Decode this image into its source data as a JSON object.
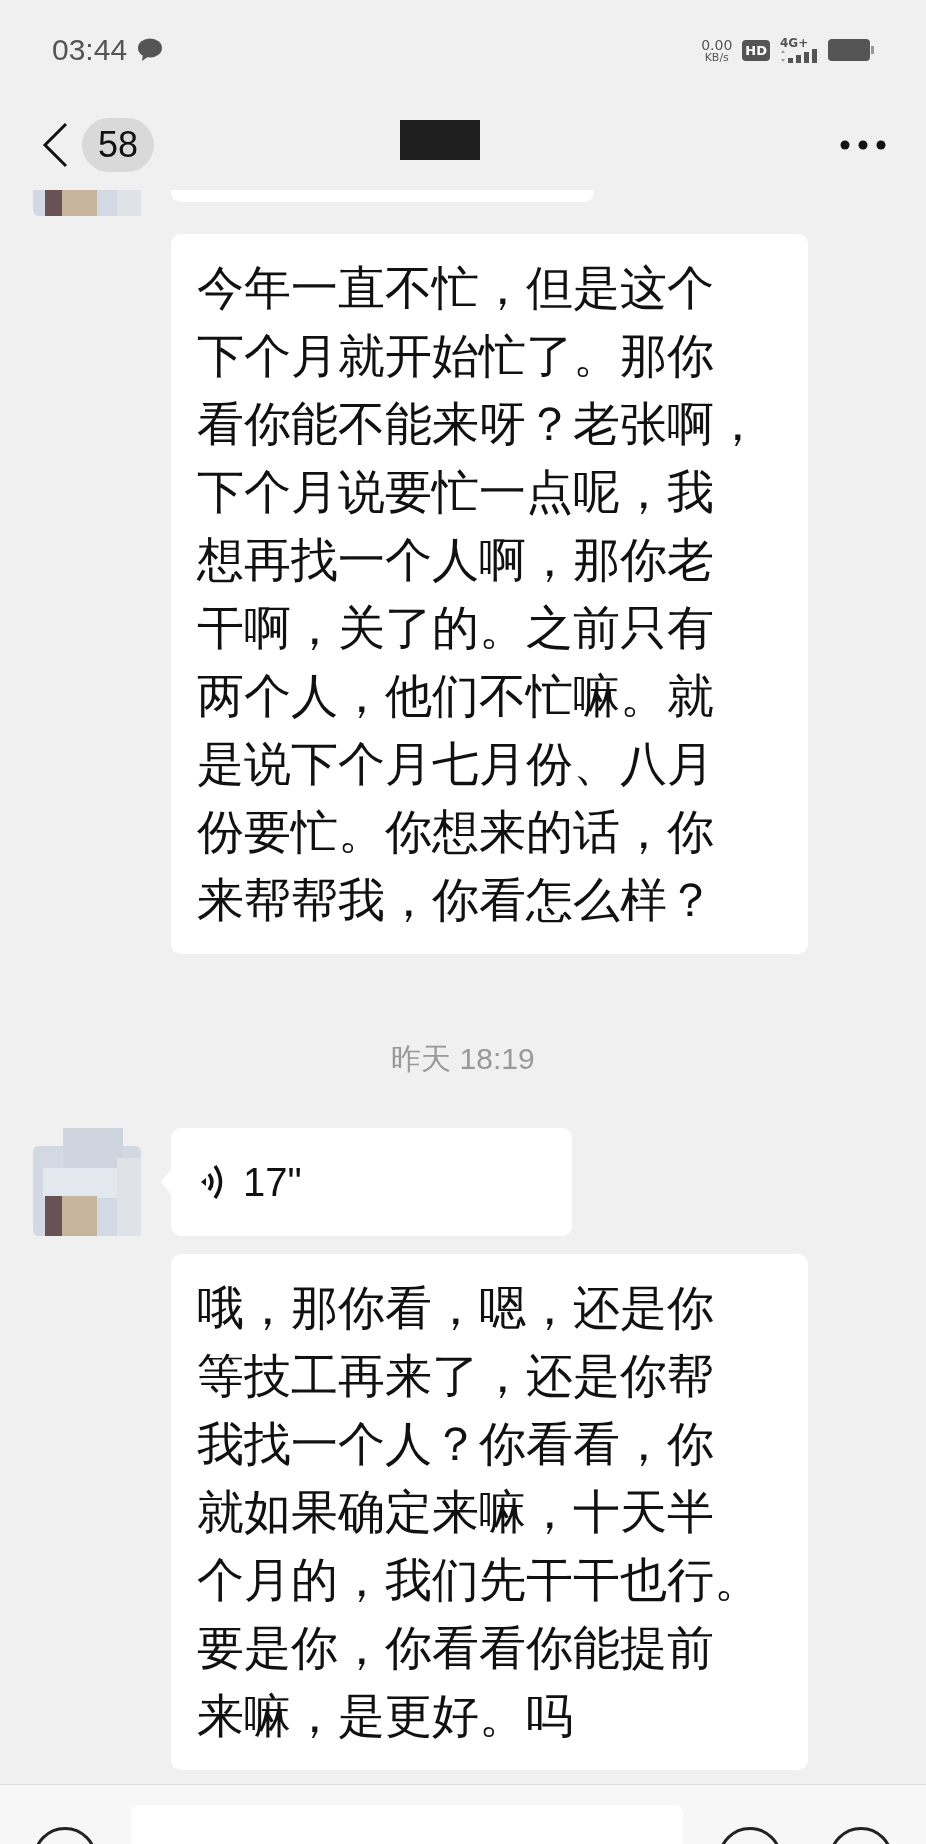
{
  "status_bar": {
    "time": "03:44",
    "net_speed": "0.00",
    "net_unit": "KB/s",
    "hd": "HD",
    "network": "4G+"
  },
  "header": {
    "unread_count": "58"
  },
  "messages": [
    {
      "kind": "partial",
      "avatar": true
    },
    {
      "kind": "text",
      "avatar": false,
      "lines": [
        "今年一直不忙，但是这个",
        "下个月就开始忙了。那你",
        "看你能不能来呀？老张啊，",
        "下个月说要忙一点呢，我",
        "想再找一个人啊，那你老",
        "干啊，关了的。之前只有",
        "两个人，他们不忙嘛。就",
        "是说下个月七月份、八月",
        "份要忙。你想来的话，你",
        "来帮帮我，你看怎么样？"
      ]
    },
    {
      "kind": "time",
      "text": "昨天 18:19"
    },
    {
      "kind": "voice",
      "avatar": true,
      "duration": "17\""
    },
    {
      "kind": "text",
      "avatar": false,
      "lines": [
        "哦，那你看，嗯，还是你",
        "等技工再来了，还是你帮",
        "我找一个人？你看看，你",
        "就如果确定来嘛，十天半",
        "个月的，我们先干干也行。",
        "要是你，你看看你能提前",
        "来嘛，是更好。吗"
      ]
    }
  ]
}
